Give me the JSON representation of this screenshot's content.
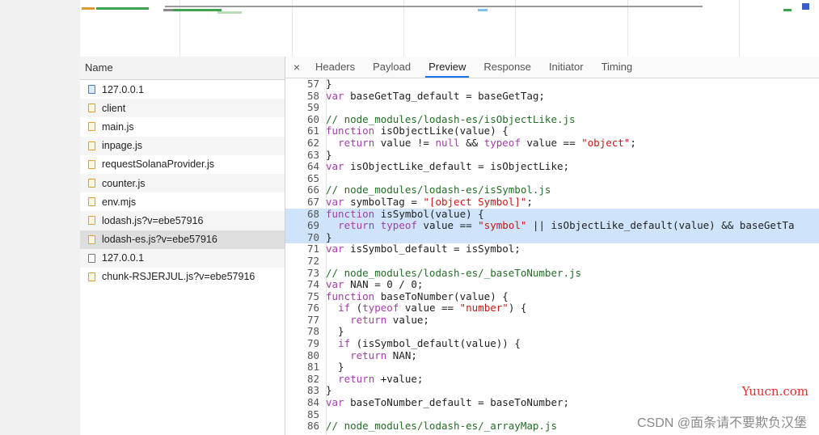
{
  "network_panel": {
    "name_header": "Name",
    "requests": [
      {
        "name": "127.0.0.1",
        "icon": "doc"
      },
      {
        "name": "client",
        "icon": "js"
      },
      {
        "name": "main.js",
        "icon": "js"
      },
      {
        "name": "inpage.js",
        "icon": "js"
      },
      {
        "name": "requestSolanaProvider.js",
        "icon": "js"
      },
      {
        "name": "counter.js",
        "icon": "js"
      },
      {
        "name": "env.mjs",
        "icon": "js"
      },
      {
        "name": "lodash.js?v=ebe57916",
        "icon": "js"
      },
      {
        "name": "lodash-es.js?v=ebe57916",
        "icon": "js",
        "selected": true
      },
      {
        "name": "127.0.0.1",
        "icon": "blank"
      },
      {
        "name": "chunk-RSJERJUL.js?v=ebe57916",
        "icon": "js"
      }
    ]
  },
  "detail_tabs": {
    "close_label": "×",
    "tabs": [
      "Headers",
      "Payload",
      "Preview",
      "Response",
      "Initiator",
      "Timing"
    ],
    "active_index": 2
  },
  "code": {
    "highlight_lines": [
      68,
      69,
      70
    ],
    "lines": [
      {
        "n": 57,
        "t": "}"
      },
      {
        "n": 58,
        "t": "var baseGetTag_default = baseGetTag;"
      },
      {
        "n": 59,
        "t": ""
      },
      {
        "n": 60,
        "t": "// node_modules/lodash-es/isObjectLike.js"
      },
      {
        "n": 61,
        "t": "function isObjectLike(value) {"
      },
      {
        "n": 62,
        "t": "  return value != null && typeof value == \"object\";"
      },
      {
        "n": 63,
        "t": "}"
      },
      {
        "n": 64,
        "t": "var isObjectLike_default = isObjectLike;"
      },
      {
        "n": 65,
        "t": ""
      },
      {
        "n": 66,
        "t": "// node_modules/lodash-es/isSymbol.js"
      },
      {
        "n": 67,
        "t": "var symbolTag = \"[object Symbol]\";"
      },
      {
        "n": 68,
        "t": "function isSymbol(value) {"
      },
      {
        "n": 69,
        "t": "  return typeof value == \"symbol\" || isObjectLike_default(value) && baseGetTa"
      },
      {
        "n": 70,
        "t": "}"
      },
      {
        "n": 71,
        "t": "var isSymbol_default = isSymbol;"
      },
      {
        "n": 72,
        "t": ""
      },
      {
        "n": 73,
        "t": "// node_modules/lodash-es/_baseToNumber.js"
      },
      {
        "n": 74,
        "t": "var NAN = 0 / 0;"
      },
      {
        "n": 75,
        "t": "function baseToNumber(value) {"
      },
      {
        "n": 76,
        "t": "  if (typeof value == \"number\") {"
      },
      {
        "n": 77,
        "t": "    return value;"
      },
      {
        "n": 78,
        "t": "  }"
      },
      {
        "n": 79,
        "t": "  if (isSymbol_default(value)) {"
      },
      {
        "n": 80,
        "t": "    return NAN;"
      },
      {
        "n": 81,
        "t": "  }"
      },
      {
        "n": 82,
        "t": "  return +value;"
      },
      {
        "n": 83,
        "t": "}"
      },
      {
        "n": 84,
        "t": "var baseToNumber_default = baseToNumber;"
      },
      {
        "n": 85,
        "t": ""
      },
      {
        "n": 86,
        "t": "// node_modules/lodash-es/_arrayMap.js"
      }
    ]
  },
  "watermarks": {
    "site": "Yuucn.com",
    "author": "CSDN @面条请不要欺负汉堡"
  },
  "colors": {
    "tab_active_underline": "#1a73e8",
    "highlight_line": "#cfe4fa",
    "keyword": "#a23ea9",
    "string": "#c41a16",
    "comment": "#236e25"
  }
}
